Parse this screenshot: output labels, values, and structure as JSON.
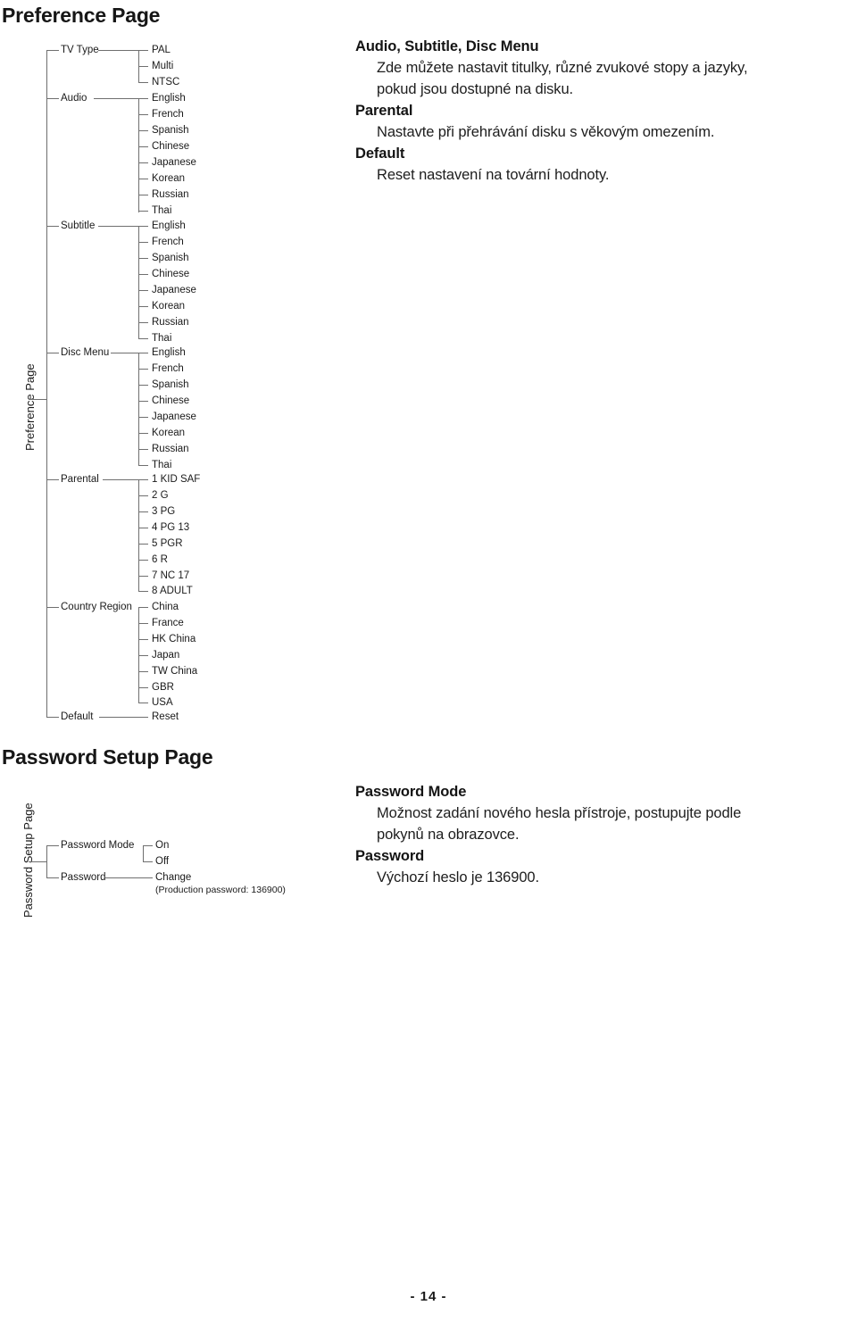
{
  "document": {
    "page_number": "- 14 -"
  },
  "preference_section": {
    "heading": "Preference Page",
    "side_label": "Preference Page",
    "categories": [
      {
        "label": "TV Type",
        "items": [
          "PAL",
          "Multi",
          "NTSC"
        ]
      },
      {
        "label": "Audio",
        "items": [
          "English",
          "French",
          "Spanish",
          "Chinese",
          "Japanese",
          "Korean",
          "Russian",
          "Thai"
        ]
      },
      {
        "label": "Subtitle",
        "items": [
          "English",
          "French",
          "Spanish",
          "Chinese",
          "Japanese",
          "Korean",
          "Russian",
          "Thai"
        ]
      },
      {
        "label": "Disc Menu",
        "items": [
          "English",
          "French",
          "Spanish",
          "Chinese",
          "Japanese",
          "Korean",
          "Russian",
          "Thai"
        ]
      },
      {
        "label": "Parental",
        "items": [
          "1  KID SAF",
          "2  G",
          "3  PG",
          "4  PG 13",
          "5  PGR",
          "6  R",
          "7  NC 17",
          "8  ADULT"
        ]
      },
      {
        "label": "Country Region",
        "items": [
          "China",
          "France",
          "HK China",
          "Japan",
          "TW China",
          "GBR",
          "USA"
        ]
      },
      {
        "label": "Default",
        "items": [
          "Reset"
        ]
      }
    ],
    "descriptions": [
      {
        "term": "Audio, Subtitle, Disc Menu",
        "lines": [
          "Zde můžete nastavit titulky, různé zvukové stopy a jazyky,",
          "pokud jsou dostupné na disku."
        ]
      },
      {
        "term": "Parental",
        "lines": [
          "Nastavte při přehrávání disku s věkovým omezením."
        ]
      },
      {
        "term": "Default",
        "lines": [
          "Reset nastavení na tovární hodnoty."
        ]
      }
    ]
  },
  "password_section": {
    "heading": "Password Setup Page",
    "side_label": "Password Setup Page",
    "categories": [
      {
        "label": "Password Mode",
        "items": [
          "On",
          "Off"
        ]
      },
      {
        "label": "Password",
        "items": [
          "Change"
        ]
      }
    ],
    "note": "(Production password: 136900)",
    "descriptions": [
      {
        "term": "Password Mode",
        "lines": [
          "Možnost zadání nového hesla přístroje, postupujte podle",
          "pokynů na obrazovce."
        ]
      },
      {
        "term": "Password",
        "lines": [
          "Výchozí heslo je 136900."
        ]
      }
    ]
  },
  "colors": {
    "text": "#1a1a1a",
    "line": "#6f6f6f",
    "background": "#ffffff"
  }
}
